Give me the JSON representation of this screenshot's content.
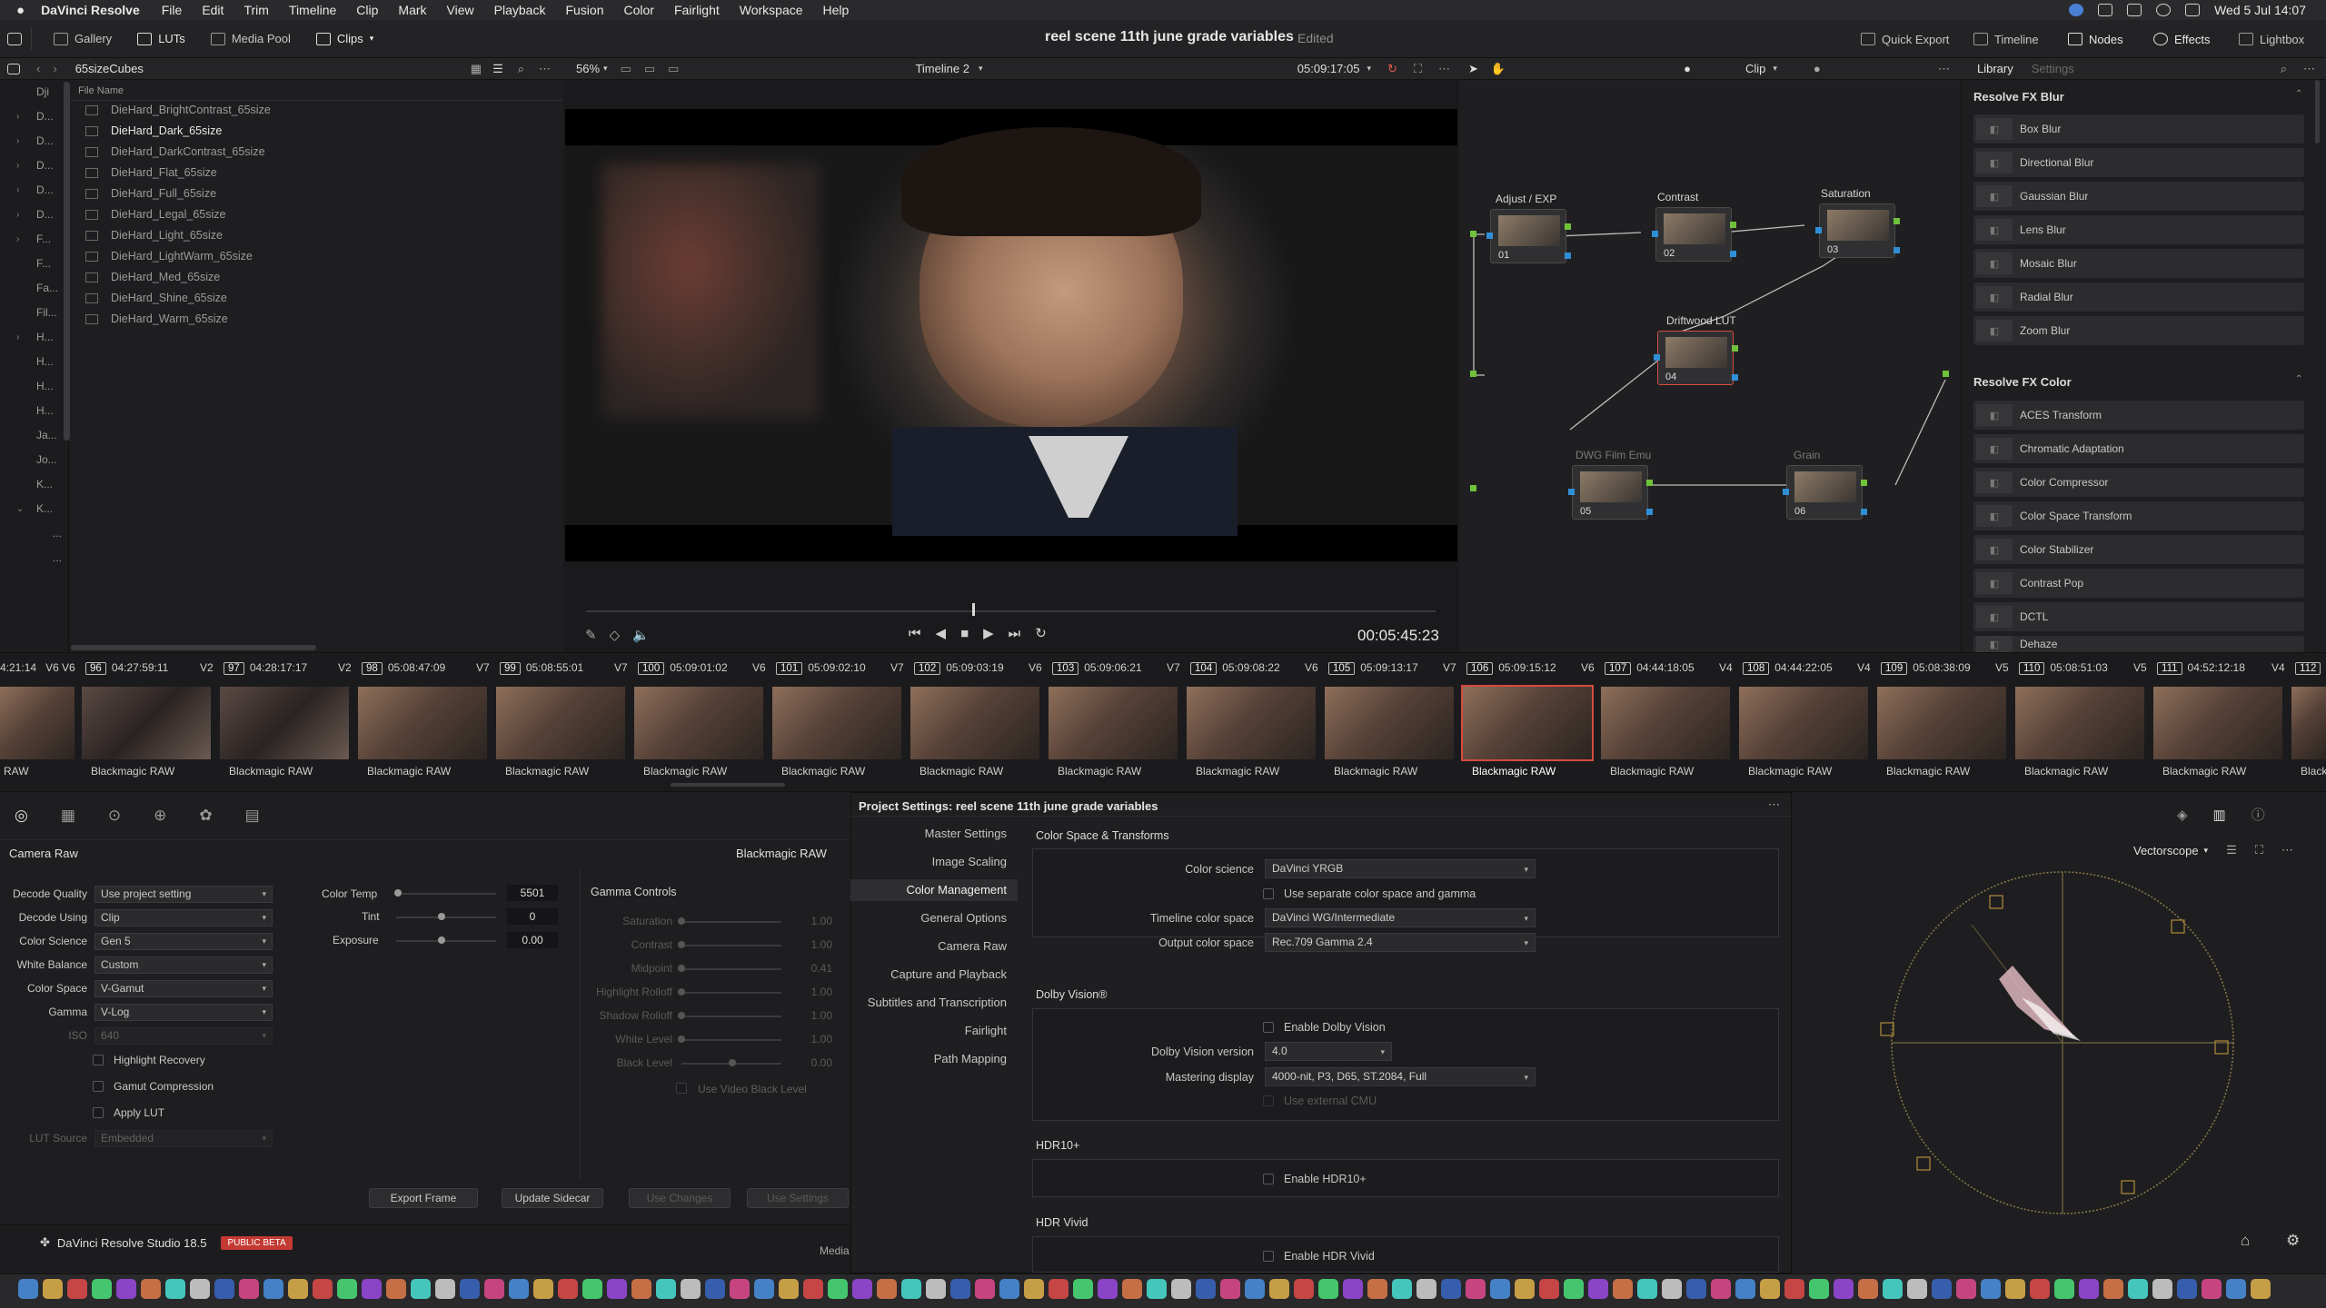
{
  "menubar": {
    "app_name": "DaVinci Resolve",
    "items": [
      "File",
      "Edit",
      "Trim",
      "Timeline",
      "Clip",
      "Mark",
      "View",
      "Playback",
      "Fusion",
      "Color",
      "Fairlight",
      "Workspace",
      "Help"
    ],
    "clock": "Wed 5 Jul  14:07"
  },
  "toolbar": {
    "gallery": "Gallery",
    "luts": "LUTs",
    "media_pool": "Media Pool",
    "clips": "Clips",
    "project_title": "reel scene 11th june grade variables",
    "edited": "Edited",
    "quick_export": "Quick Export",
    "timeline": "Timeline",
    "nodes": "Nodes",
    "effects": "Effects",
    "lightbox": "Lightbox"
  },
  "lut_browser": {
    "folder": "65sizeCubes",
    "column": "File Name",
    "tree": [
      "Dji",
      "D...",
      "D...",
      "D...",
      "D...",
      "D...",
      "F...",
      "F...",
      "Fa...",
      "Fil...",
      "H...",
      "H...",
      "H...",
      "H...",
      "Ja...",
      "Jo...",
      "K...",
      "K...",
      "...",
      "..."
    ],
    "files": [
      "DieHard_BrightContrast_65size",
      "DieHard_Dark_65size",
      "DieHard_DarkContrast_65size",
      "DieHard_Flat_65size",
      "DieHard_Full_65size",
      "DieHard_Legal_65size",
      "DieHard_Light_65size",
      "DieHard_LightWarm_65size",
      "DieHard_Med_65size",
      "DieHard_Shine_65size",
      "DieHard_Warm_65size"
    ],
    "selected_index": 1
  },
  "viewer": {
    "zoom": "56%",
    "timeline_name": "Timeline 2",
    "source_tc": "05:09:17:05",
    "playhead_tc": "00:05:45:23",
    "clip_mode": "Clip"
  },
  "nodes": [
    {
      "label": "Adjust / EXP",
      "num": "01"
    },
    {
      "label": "Contrast",
      "num": "02"
    },
    {
      "label": "Saturation",
      "num": "03"
    },
    {
      "label": "Driftwood LUT",
      "num": "04"
    },
    {
      "label": "DWG Film Emu",
      "num": "05"
    },
    {
      "label": "Grain",
      "num": "06"
    }
  ],
  "library": {
    "tab_library": "Library",
    "tab_settings": "Settings",
    "section1": "Resolve FX Blur",
    "blur": [
      "Box Blur",
      "Directional Blur",
      "Gaussian Blur",
      "Lens Blur",
      "Mosaic Blur",
      "Radial Blur",
      "Zoom Blur"
    ],
    "section2": "Resolve FX Color",
    "color": [
      "ACES Transform",
      "Chromatic Adaptation",
      "Color Compressor",
      "Color Space Transform",
      "Color Stabilizer",
      "Contrast Pop",
      "DCTL",
      "Dehaze"
    ]
  },
  "clips": [
    {
      "track": "V6",
      "num": "96",
      "tc": "04:27:59:11",
      "label": "Blackmagic RAW"
    },
    {
      "track": "V2",
      "num": "97",
      "tc": "04:28:17:17",
      "label": "Blackmagic RAW"
    },
    {
      "track": "V2",
      "num": "98",
      "tc": "05:08:47:09",
      "label": "Blackmagic RAW"
    },
    {
      "track": "V7",
      "num": "99",
      "tc": "05:08:55:01",
      "label": "Blackmagic RAW"
    },
    {
      "track": "V7",
      "num": "100",
      "tc": "05:09:01:02",
      "label": "Blackmagic RAW"
    },
    {
      "track": "V6",
      "num": "101",
      "tc": "05:09:02:10",
      "label": "Blackmagic RAW"
    },
    {
      "track": "V7",
      "num": "102",
      "tc": "05:09:03:19",
      "label": "Blackmagic RAW"
    },
    {
      "track": "V6",
      "num": "103",
      "tc": "05:09:06:21",
      "label": "Blackmagic RAW"
    },
    {
      "track": "V7",
      "num": "104",
      "tc": "05:09:08:22",
      "label": "Blackmagic RAW"
    },
    {
      "track": "V6",
      "num": "105",
      "tc": "05:09:13:17",
      "label": "Blackmagic RAW"
    },
    {
      "track": "V7",
      "num": "106",
      "tc": "05:09:15:12",
      "label": "Blackmagic RAW"
    },
    {
      "track": "V6",
      "num": "107",
      "tc": "04:44:18:05",
      "label": "Blackmagic RAW"
    },
    {
      "track": "V4",
      "num": "108",
      "tc": "04:44:22:05",
      "label": "Blackmagic RAW"
    },
    {
      "track": "V4",
      "num": "109",
      "tc": "05:08:38:09",
      "label": "Blackmagic RAW"
    },
    {
      "track": "V5",
      "num": "110",
      "tc": "05:08:51:03",
      "label": "Blackmagic RAW"
    },
    {
      "track": "V5",
      "num": "111",
      "tc": "04:52:12:18",
      "label": "Blackmagic RAW"
    },
    {
      "track": "V4",
      "num": "112",
      "tc": "",
      "label": "Blackm"
    }
  ],
  "clip_strip_lead": {
    "tc": "4:21:14",
    "track": "V6",
    "label": "RAW"
  },
  "camera_raw": {
    "title": "Camera Raw",
    "format": "Blackmagic RAW",
    "fields": [
      {
        "label": "Decode Quality",
        "value": "Use project setting"
      },
      {
        "label": "Decode Using",
        "value": "Clip"
      },
      {
        "label": "Color Science",
        "value": "Gen 5"
      },
      {
        "label": "White Balance",
        "value": "Custom"
      },
      {
        "label": "Color Space",
        "value": "V-Gamut"
      },
      {
        "label": "Gamma",
        "value": "V-Log"
      },
      {
        "label": "ISO",
        "value": "640"
      }
    ],
    "checks": [
      "Highlight Recovery",
      "Gamut Compression",
      "Apply LUT"
    ],
    "lut_source_label": "LUT Source",
    "lut_source_value": "Embedded",
    "color_temp_label": "Color Temp",
    "color_temp": "5501",
    "tint_label": "Tint",
    "tint": "0",
    "exposure_label": "Exposure",
    "exposure": "0.00",
    "gamma_controls": "Gamma Controls",
    "gamma_rows": [
      {
        "label": "Saturation",
        "value": "1.00"
      },
      {
        "label": "Contrast",
        "value": "1.00"
      },
      {
        "label": "Midpoint",
        "value": "0.41"
      },
      {
        "label": "Highlight Rolloff",
        "value": "1.00"
      },
      {
        "label": "Shadow Rolloff",
        "value": "1.00"
      },
      {
        "label": "White Level",
        "value": "1.00"
      },
      {
        "label": "Black Level",
        "value": "0.00"
      }
    ],
    "use_video_black": "Use Video Black Level",
    "buttons": [
      "Export Frame",
      "Update Sidecar",
      "Use Changes",
      "Use Settings"
    ]
  },
  "project_settings": {
    "title": "Project Settings:  reel scene 11th june grade variables",
    "nav": [
      "Master Settings",
      "Image Scaling",
      "Color Management",
      "General Options",
      "Camera Raw",
      "Capture and Playback",
      "Subtitles and Transcription",
      "Fairlight",
      "Path Mapping"
    ],
    "active_nav": "Color Management",
    "section_cst": "Color Space & Transforms",
    "color_science_label": "Color science",
    "color_science": "DaVinci YRGB",
    "separate_cs": "Use separate color space and gamma",
    "timeline_cs_label": "Timeline color space",
    "timeline_cs": "DaVinci WG/Intermediate",
    "output_cs_label": "Output color space",
    "output_cs": "Rec.709 Gamma 2.4",
    "section_dolby": "Dolby Vision®",
    "enable_dolby": "Enable Dolby Vision",
    "dolby_version_label": "Dolby Vision version",
    "dolby_version": "4.0",
    "mastering_label": "Mastering display",
    "mastering": "4000-nit, P3, D65, ST.2084, Full",
    "external_cmu": "Use external CMU",
    "section_hdr10": "HDR10+",
    "enable_hdr10": "Enable HDR10+",
    "section_vivid": "HDR Vivid",
    "enable_vivid": "Enable HDR Vivid"
  },
  "scopes": {
    "mode": "Vectorscope"
  },
  "footer": {
    "brand": "DaVinci Resolve Studio 18.5",
    "badge": "PUBLIC BETA",
    "media": "Media"
  }
}
